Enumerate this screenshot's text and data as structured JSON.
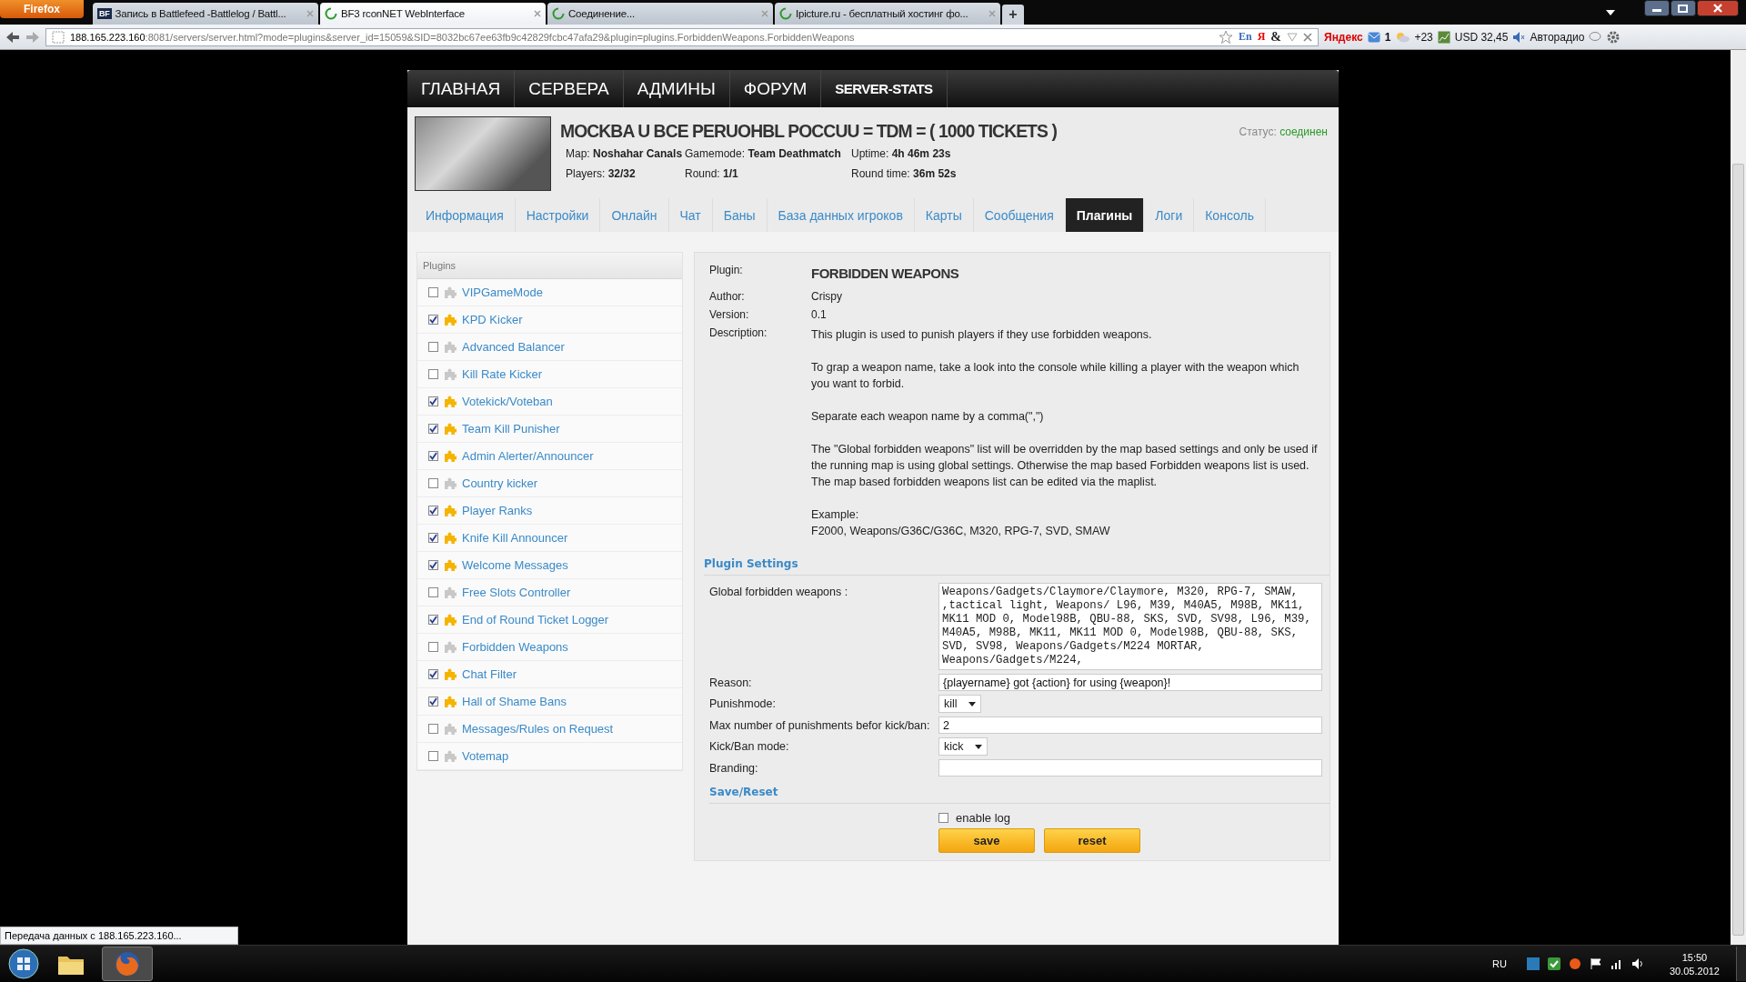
{
  "browser": {
    "menu_button": "Firefox",
    "tabs": [
      {
        "title": "Запись в Battlefeed -Battlelog / Battl...",
        "kind": "logo",
        "icon_text": "BF",
        "selected": false
      },
      {
        "title": "BF3 rconNET WebInterface",
        "kind": "loading",
        "selected": true
      },
      {
        "title": "Соединение...",
        "kind": "loading",
        "selected": false
      },
      {
        "title": "Ipicture.ru - бесплатный хостинг фо...",
        "kind": "loading",
        "selected": false
      }
    ],
    "new_tab": "+",
    "url": {
      "host": "188.165.223.160",
      "rest": ":8081/servers/server.html?mode=plugins&server_id=15059&SID=8032bc67ee63fb9c42829fcbc47afa29&plugin=plugins.ForbiddenWeapons.ForbiddenWeapons"
    },
    "url_glyphs": [
      "En",
      "Я",
      "&"
    ],
    "toolbar": [
      "Яндекс",
      "1",
      "+23",
      "USD 32,45",
      "Авторадио"
    ],
    "status_text": "Передача данных с 188.165.223.160..."
  },
  "site": {
    "nav": [
      "ГЛАВНАЯ",
      "СЕРВЕРА",
      "АДМИНЫ",
      "ФОРУМ",
      "SERVER-STATS"
    ],
    "server": {
      "name": "MOCKBA U BCE PERUOHBL POCCUU = TDM = ( 1000 TICKETS )",
      "stats": [
        {
          "label": "Map:",
          "value": "Noshahar Canals"
        },
        {
          "label": "Gamemode:",
          "value": "Team Deathmatch"
        },
        {
          "label": "Uptime:",
          "value": "4h 46m 23s"
        },
        {
          "label": "Players:",
          "value": "32/32"
        },
        {
          "label": "Round:",
          "value": "1/1"
        },
        {
          "label": "Round time:",
          "value": "36m 52s"
        }
      ],
      "status_label": "Статус:",
      "status_value": "соединен"
    },
    "tabs": [
      {
        "label": "Информация",
        "selected": false
      },
      {
        "label": "Настройки",
        "selected": false
      },
      {
        "label": "Онлайн",
        "selected": false
      },
      {
        "label": "Чат",
        "selected": false
      },
      {
        "label": "Баны",
        "selected": false
      },
      {
        "label": "База данных игроков",
        "selected": false
      },
      {
        "label": "Карты",
        "selected": false
      },
      {
        "label": "Сообщения",
        "selected": false
      },
      {
        "label": "Плагины",
        "selected": true
      },
      {
        "label": "Логи",
        "selected": false
      },
      {
        "label": "Консоль",
        "selected": false
      }
    ],
    "plugins": {
      "title": "Plugins",
      "items": [
        {
          "name": "VIPGameMode",
          "enabled": false
        },
        {
          "name": "KPD Kicker",
          "enabled": true
        },
        {
          "name": "Advanced Balancer",
          "enabled": false
        },
        {
          "name": "Kill Rate Kicker",
          "enabled": false
        },
        {
          "name": "Votekick/Voteban",
          "enabled": true
        },
        {
          "name": "Team Kill Punisher",
          "enabled": true
        },
        {
          "name": "Admin Alerter/Announcer",
          "enabled": true
        },
        {
          "name": "Country kicker",
          "enabled": false
        },
        {
          "name": "Player Ranks",
          "enabled": true
        },
        {
          "name": "Knife Kill Announcer",
          "enabled": true
        },
        {
          "name": "Welcome Messages",
          "enabled": true
        },
        {
          "name": "Free Slots Controller",
          "enabled": false
        },
        {
          "name": "End of Round Ticket Logger",
          "enabled": true
        },
        {
          "name": "Forbidden Weapons",
          "enabled": false
        },
        {
          "name": "Chat Filter",
          "enabled": true
        },
        {
          "name": "Hall of Shame Bans",
          "enabled": true
        },
        {
          "name": "Messages/Rules on Request",
          "enabled": false
        },
        {
          "name": "Votemap",
          "enabled": false
        }
      ]
    },
    "detail": {
      "plugin_label": "Plugin:",
      "plugin_name": "FORBIDDEN WEAPONS",
      "info": [
        {
          "label": "Author:",
          "value": "Crispy"
        },
        {
          "label": "Version:",
          "value": "0.1"
        }
      ],
      "description_label": "Description:",
      "description": [
        "This plugin is used to punish players if they use forbidden weapons.",
        "To grap a weapon name, take a look into the console while killing a player with the weapon which you want to forbid.",
        "Separate each weapon name by a comma(\",\")",
        "The \"Global forbidden weapons\" list will be overridden by the map based settings and only be used if the running map is using global settings. Otherwise the map based Forbidden weapons list is used. The map based forbidden weapons list can be edited via the maplist.",
        "Example:\nF2000, Weapons/G36C/G36C, M320, RPG-7, SVD, SMAW"
      ]
    },
    "settings": {
      "title": "Plugin Settings",
      "fields": [
        {
          "label": "Global forbidden weapons :",
          "kind": "textarea",
          "value": "Weapons/Gadgets/Claymore/Claymore, M320, RPG-7, SMAW, ,tactical light,  Weapons/ L96, M39, M40A5, M98B, MK11, MK11 MOD 0, Model98B, QBU-88, SKS, SVD, SV98, L96, M39, M40A5, M98B, MK11, MK11 MOD 0, Model98B, QBU-88, SKS, SVD, SV98, Weapons/Gadgets/M224 MORTAR, Weapons/Gadgets/M224,"
        },
        {
          "label": "Reason:",
          "kind": "text",
          "value": "{playername} got {action} for using {weapon}!"
        },
        {
          "label": "Punishmode:",
          "kind": "select",
          "value": "kill"
        },
        {
          "label": "Max number of punishments befor kick/ban:",
          "kind": "text",
          "value": "2"
        },
        {
          "label": "Kick/Ban mode:",
          "kind": "select",
          "value": "kick"
        },
        {
          "label": "Branding:",
          "kind": "text"
        }
      ],
      "save_title": "Save/Reset",
      "enable_log": {
        "label": "enable log",
        "checked": false
      },
      "buttons": [
        "save",
        "reset"
      ]
    }
  },
  "taskbar": {
    "apps": [
      {
        "kind": "explorer",
        "selected": false
      },
      {
        "kind": "firefox",
        "selected": true
      }
    ],
    "language": "RU",
    "time": "15:50",
    "date": "30.05.2012"
  }
}
